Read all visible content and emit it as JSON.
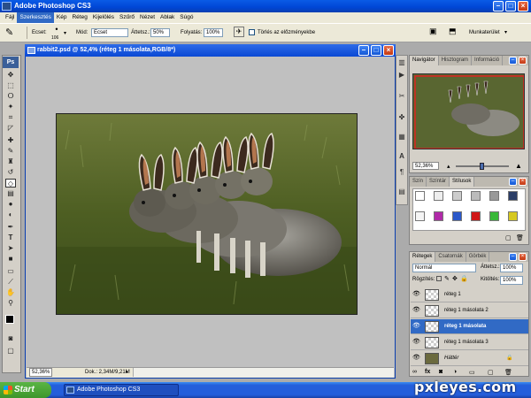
{
  "app": {
    "title": "Adobe Photoshop CS3"
  },
  "menu": [
    "Fájl",
    "Szerkesztés",
    "Kép",
    "Réteg",
    "Kijelölés",
    "Szűrő",
    "Nézet",
    "Ablak",
    "Súgó"
  ],
  "options": {
    "brush_label": "Ecset:",
    "brush_size": "106",
    "mode_label": "Mód:",
    "mode_value": "Ecset",
    "opacity_label": "Áttetsz.:",
    "opacity_value": "50%",
    "flow_label": "Folyatás:",
    "flow_value": "100%",
    "erase_history_label": "Törlés az előzményekbe",
    "workspace_label": "Munkaterület"
  },
  "document": {
    "title": "rabbit2.psd @ 52,4% (réteg 1 másolata,RGB/8*)",
    "zoom": "52,36%",
    "doc_size": "Dok.: 2,34M/9,21M"
  },
  "navigator": {
    "tabs": [
      "Navigátor",
      "Hisztogram",
      "Információ"
    ],
    "zoom": "52,36%"
  },
  "styles": {
    "tabs": [
      "Szín",
      "Színtár",
      "Stílusok"
    ]
  },
  "layers": {
    "tabs": [
      "Rétegek",
      "Csatornák",
      "Görbék"
    ],
    "blend_mode": "Normál",
    "opacity_label": "Áttetsz.:",
    "opacity_value": "100%",
    "lock_label": "Rögzítés:",
    "fill_label": "Kitöltés:",
    "fill_value": "100%",
    "items": [
      {
        "name": "réteg 1",
        "selected": false
      },
      {
        "name": "réteg 1 másolata 2",
        "selected": false
      },
      {
        "name": "réteg 1 másolata",
        "selected": true
      },
      {
        "name": "réteg 1 másolata 3",
        "selected": false
      },
      {
        "name": "Háttér",
        "selected": false
      }
    ]
  },
  "taskbar": {
    "start_label": "Start",
    "task_label": "Adobe Photoshop CS3"
  },
  "watermark": "pxleyes.com"
}
